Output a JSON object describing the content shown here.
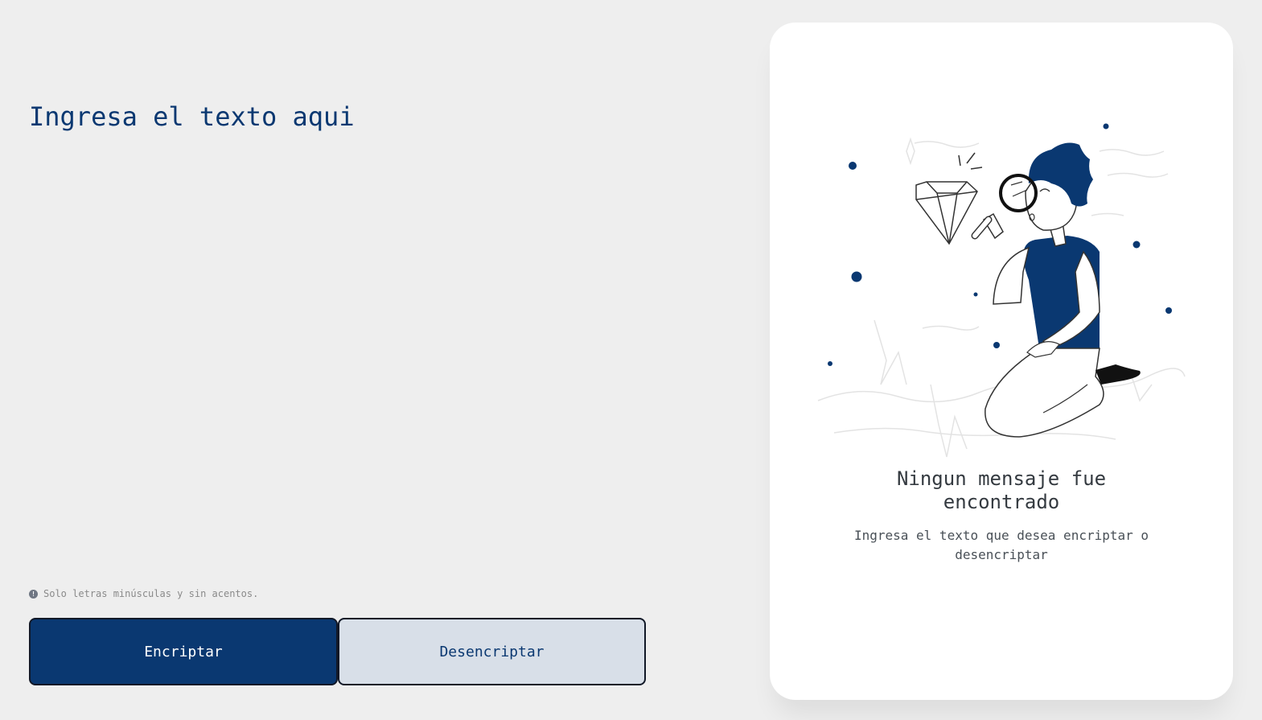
{
  "input": {
    "placeholder": "Ingresa el texto aqui",
    "value": ""
  },
  "hint": {
    "icon": "info-icon",
    "icon_glyph": "!",
    "text": "Solo letras minúsculas y sin acentos."
  },
  "buttons": {
    "encrypt_label": "Encriptar",
    "decrypt_label": "Desencriptar"
  },
  "output_panel": {
    "illustration": "person-with-magnifier-illustration",
    "title": "Ningun mensaje fue encontrado",
    "subtitle": "Ingresa el texto que desea encriptar o desencriptar"
  },
  "colors": {
    "accent": "#0a3871",
    "background": "#eeeeee",
    "panel": "#ffffff",
    "secondary_button": "#d8dfe8"
  }
}
